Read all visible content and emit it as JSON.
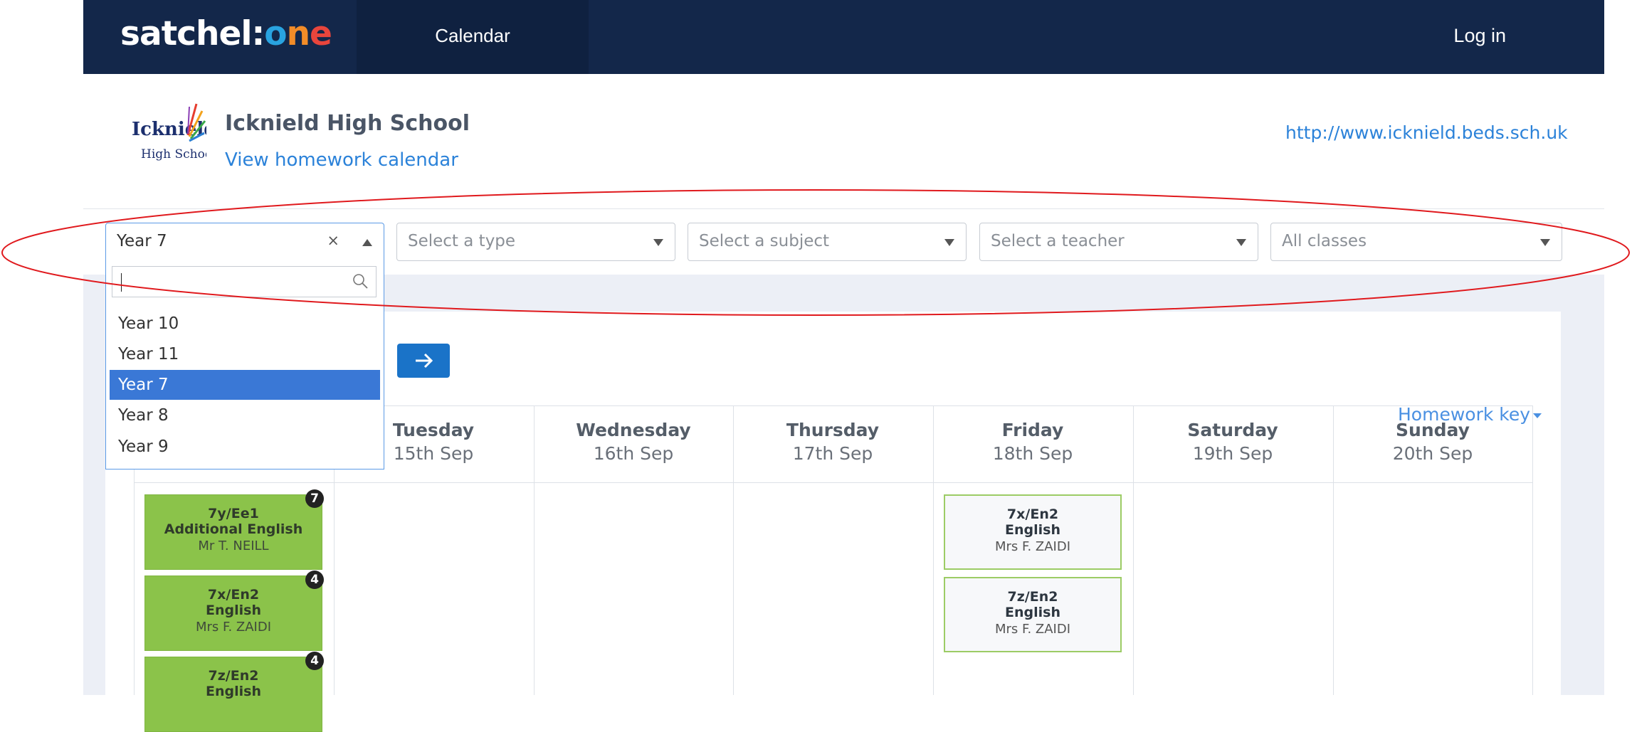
{
  "header": {
    "logo": {
      "part1": "satchel:",
      "o": "o",
      "n": "n",
      "e": "e"
    },
    "nav_calendar": "Calendar",
    "login": "Log in"
  },
  "school": {
    "logo_text_1": "Icknield",
    "logo_text_2": "High School",
    "name": "Icknield High School",
    "homework_link": "View homework calendar",
    "website": "http://www.icknield.beds.sch.uk"
  },
  "filters": {
    "year": {
      "value": "Year 7",
      "clear": "×"
    },
    "type": {
      "placeholder": "Select a type"
    },
    "subject": {
      "placeholder": "Select a subject"
    },
    "teacher": {
      "placeholder": "Select a teacher"
    },
    "classes": {
      "value": "All classes"
    }
  },
  "year_dropdown": {
    "search_value": "",
    "options": [
      "Year 10",
      "Year 11",
      "Year 7",
      "Year 8",
      "Year 9"
    ],
    "selected": "Year 7"
  },
  "homework_key": "Homework key",
  "calendar": {
    "days": [
      {
        "day": "Tuesday",
        "date": "15th Sep"
      },
      {
        "day": "Wednesday",
        "date": "16th Sep"
      },
      {
        "day": "Thursday",
        "date": "17th Sep"
      },
      {
        "day": "Friday",
        "date": "18th Sep"
      },
      {
        "day": "Saturday",
        "date": "19th Sep"
      },
      {
        "day": "Sunday",
        "date": "20th Sep"
      }
    ],
    "monday_events": [
      {
        "class": "7y/Ee1",
        "subject": "Additional English",
        "teacher": "Mr T. NEILL",
        "count": "7"
      },
      {
        "class": "7x/En2",
        "subject": "English",
        "teacher": "Mrs F. ZAIDI",
        "count": "4"
      },
      {
        "class": "7z/En2",
        "subject": "English",
        "teacher": "",
        "count": "4"
      }
    ],
    "friday_events": [
      {
        "class": "7x/En2",
        "subject": "English",
        "teacher": "Mrs F. ZAIDI"
      },
      {
        "class": "7z/En2",
        "subject": "English",
        "teacher": "Mrs F. ZAIDI"
      }
    ]
  },
  "colors": {
    "nav_bg": "#13274a",
    "accent_blue": "#2b82d9",
    "event_green": "#8bc34a",
    "annotation_red": "#e0191d"
  }
}
